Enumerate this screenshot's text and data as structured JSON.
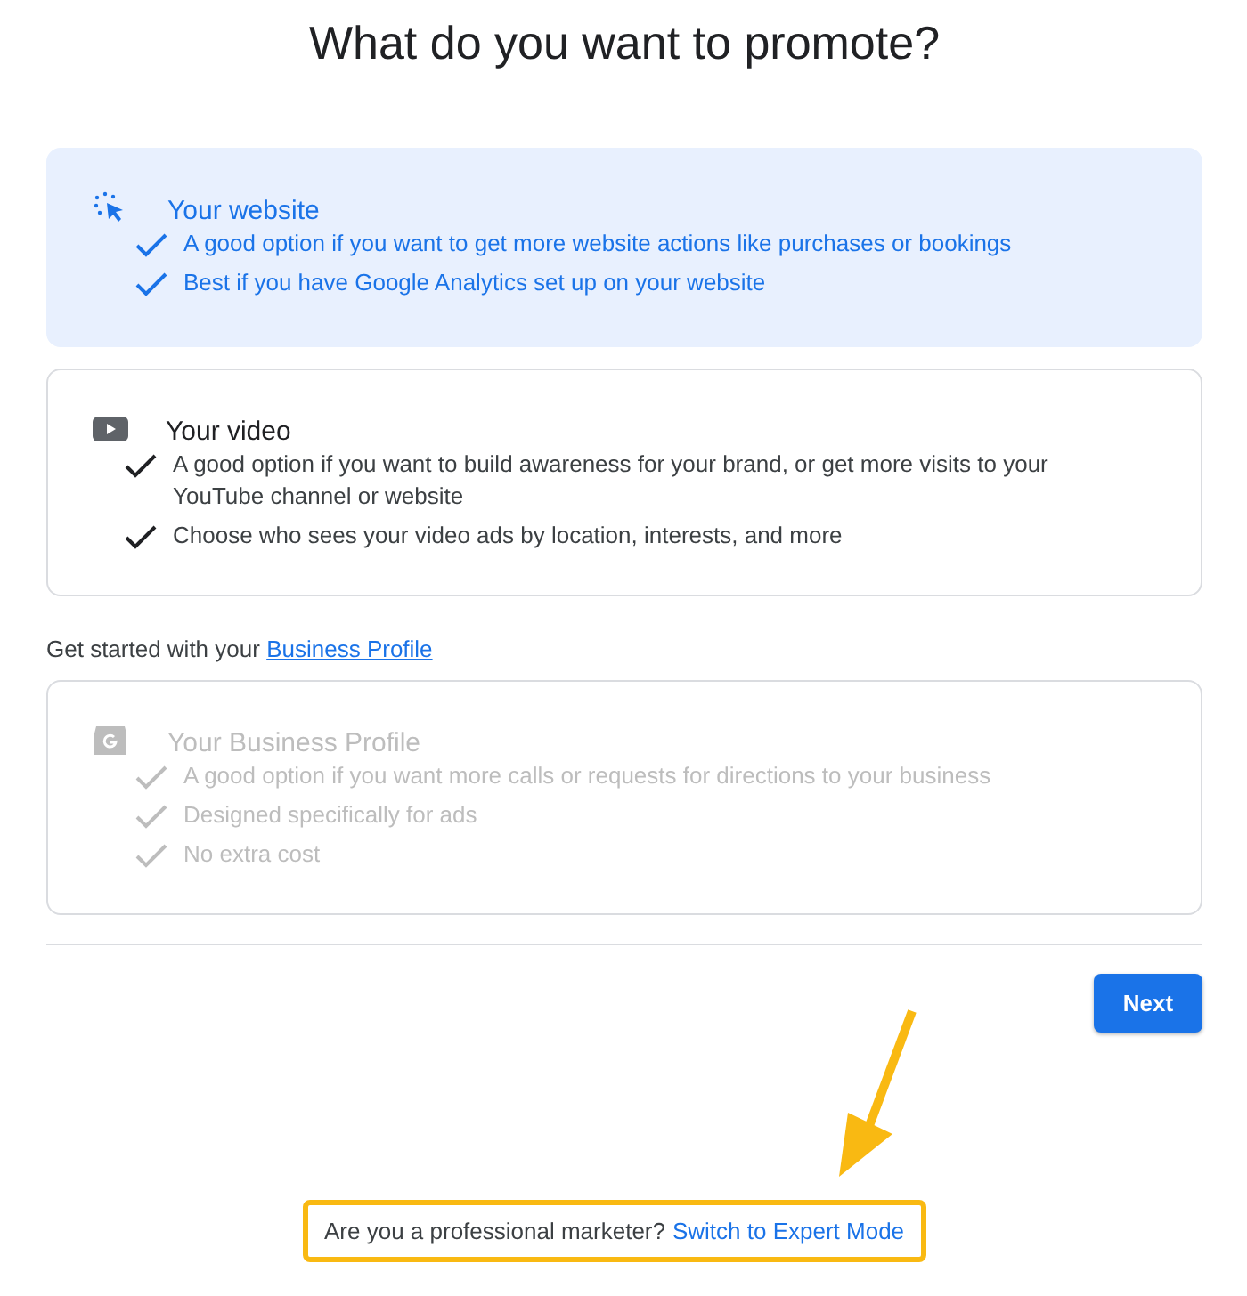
{
  "title": "What do you want to promote?",
  "options": [
    {
      "kind": "website",
      "title": "Your website",
      "selected": true,
      "disabled": false,
      "points": [
        "A good option if you want to get more website actions like purchases or bookings",
        "Best if you have Google Analytics set up on your website"
      ]
    },
    {
      "kind": "video",
      "title": "Your video",
      "selected": false,
      "disabled": false,
      "points": [
        "A good option if you want to build awareness for your brand, or get more visits to your YouTube channel or website",
        "Choose who sees your video ads by location, interests, and more"
      ]
    }
  ],
  "business_prompt": {
    "text": "Get started with your",
    "link": "Business Profile"
  },
  "business_options": [
    {
      "kind": "business",
      "title": "Your Business Profile",
      "selected": false,
      "disabled": true,
      "points": [
        "A good option if you want more calls or requests for directions to your business",
        "Designed specifically for ads",
        "No extra cost"
      ]
    }
  ],
  "next_button": "Next",
  "expert_prompt": {
    "text": "Are you a professional marketer?",
    "link": "Switch to Expert Mode"
  }
}
